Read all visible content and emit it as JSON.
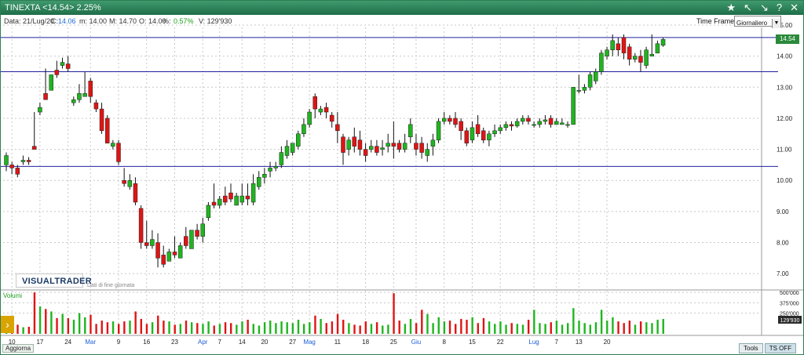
{
  "window": {
    "title": "TINEXTA <14.54> 2.25%",
    "icons": [
      "star-icon",
      "arrow-nw-icon",
      "arrow-se-icon",
      "help-icon",
      "close-icon"
    ]
  },
  "info": {
    "date": "Data: 21/Lug/20",
    "close_label": "C:",
    "close_value": "14.06",
    "min": "m: 14.00",
    "max": "M: 14.70",
    "open": "O: 14.00",
    "pct_label": "%:",
    "pct_value": "0.57%",
    "vol": "V: 129'930",
    "timeframe_label": "Time Frame",
    "timeframe_value": "Giornaliero"
  },
  "brand": {
    "name": "VISUALTRADER",
    "subtitle": "Dati di fine giornata"
  },
  "volume_label": "Volumi",
  "last_price_tag": "14.54",
  "volume_tag": "129'930",
  "bottom": {
    "update": "Aggiorna",
    "tools": "Tools",
    "ts": "TS OFF"
  },
  "colors": {
    "up": "#1fb51f",
    "down": "#e01414",
    "grid": "#c8c8c8",
    "hline": "#2020a0",
    "brand": "#1a3a66"
  },
  "chart_data": {
    "type": "candlestick",
    "price_axis": {
      "min": 6.5,
      "max": 15.0,
      "ticks": [
        "7.00",
        "8.00",
        "9.00",
        "10.00",
        "11.00",
        "12.00",
        "13.00",
        "14.00",
        "15.00"
      ]
    },
    "horizontal_lines": [
      14.6,
      13.5,
      10.45
    ],
    "volume_axis": {
      "max": 520000,
      "ticks": [
        "500'000",
        "375'000",
        "250'000"
      ]
    },
    "x_ticks": [
      {
        "label": "10",
        "i": 1,
        "month": false
      },
      {
        "label": "17",
        "i": 6,
        "month": false
      },
      {
        "label": "24",
        "i": 11,
        "month": false
      },
      {
        "label": "Mar",
        "i": 15,
        "month": true
      },
      {
        "label": "9",
        "i": 20,
        "month": false
      },
      {
        "label": "16",
        "i": 25,
        "month": false
      },
      {
        "label": "23",
        "i": 30,
        "month": false
      },
      {
        "label": "Apr",
        "i": 35,
        "month": true
      },
      {
        "label": "7",
        "i": 38,
        "month": false
      },
      {
        "label": "14",
        "i": 42,
        "month": false
      },
      {
        "label": "20",
        "i": 46,
        "month": false
      },
      {
        "label": "27",
        "i": 51,
        "month": false
      },
      {
        "label": "Mag",
        "i": 54,
        "month": true
      },
      {
        "label": "11",
        "i": 59,
        "month": false
      },
      {
        "label": "18",
        "i": 64,
        "month": false
      },
      {
        "label": "25",
        "i": 69,
        "month": false
      },
      {
        "label": "Giu",
        "i": 73,
        "month": true
      },
      {
        "label": "8",
        "i": 78,
        "month": false
      },
      {
        "label": "15",
        "i": 83,
        "month": false
      },
      {
        "label": "22",
        "i": 88,
        "month": false
      },
      {
        "label": "Lug",
        "i": 94,
        "month": true
      },
      {
        "label": "7",
        "i": 98,
        "month": false
      },
      {
        "label": "13",
        "i": 102,
        "month": false
      },
      {
        "label": "20",
        "i": 107,
        "month": false
      }
    ],
    "candles": [
      [
        10.5,
        10.9,
        10.8,
        10.3,
        160000
      ],
      [
        10.5,
        10.6,
        10.4,
        10.2,
        90000
      ],
      [
        10.4,
        10.5,
        10.2,
        10.1,
        110000
      ],
      [
        10.6,
        10.8,
        10.65,
        10.5,
        80000
      ],
      [
        10.65,
        10.75,
        10.6,
        10.5,
        85000
      ],
      [
        11.1,
        12.2,
        11.0,
        11.0,
        500000
      ],
      [
        12.2,
        12.5,
        12.35,
        12.1,
        330000
      ],
      [
        12.8,
        13.6,
        12.6,
        12.6,
        300000
      ],
      [
        12.9,
        13.4,
        13.4,
        12.9,
        270000
      ],
      [
        13.55,
        13.85,
        13.4,
        13.3,
        190000
      ],
      [
        13.7,
        13.95,
        13.8,
        13.6,
        240000
      ],
      [
        13.75,
        14.0,
        13.6,
        13.5,
        190000
      ],
      [
        12.5,
        12.7,
        12.6,
        12.4,
        170000
      ],
      [
        12.6,
        13.1,
        12.8,
        12.5,
        250000
      ],
      [
        12.7,
        13.5,
        12.8,
        12.7,
        200000
      ],
      [
        13.2,
        13.3,
        12.7,
        12.5,
        230000
      ],
      [
        12.5,
        12.6,
        12.3,
        12.2,
        120000
      ],
      [
        12.3,
        12.5,
        11.6,
        11.5,
        160000
      ],
      [
        12.0,
        12.1,
        11.2,
        11.2,
        140000
      ],
      [
        11.1,
        11.3,
        11.2,
        11.0,
        150000
      ],
      [
        11.2,
        11.3,
        10.6,
        10.5,
        120000
      ],
      [
        10.0,
        10.4,
        9.9,
        9.8,
        150000
      ],
      [
        9.8,
        10.2,
        10.0,
        9.7,
        160000
      ],
      [
        9.9,
        10.1,
        9.3,
        9.2,
        270000
      ],
      [
        9.1,
        9.2,
        8.0,
        7.8,
        180000
      ],
      [
        8.0,
        8.7,
        7.9,
        7.8,
        120000
      ],
      [
        7.9,
        8.4,
        8.1,
        7.8,
        140000
      ],
      [
        8.0,
        8.3,
        7.5,
        7.2,
        220000
      ],
      [
        7.6,
        7.9,
        7.3,
        7.2,
        160000
      ],
      [
        7.4,
        7.8,
        7.7,
        7.4,
        150000
      ],
      [
        7.7,
        8.2,
        7.6,
        7.5,
        110000
      ],
      [
        7.5,
        8.0,
        7.9,
        7.5,
        120000
      ],
      [
        8.2,
        8.5,
        7.9,
        7.8,
        160000
      ],
      [
        7.8,
        8.1,
        8.4,
        7.8,
        140000
      ],
      [
        8.4,
        8.6,
        8.2,
        8.1,
        130000
      ],
      [
        8.2,
        8.8,
        8.6,
        8.0,
        120000
      ],
      [
        8.8,
        9.3,
        9.2,
        8.7,
        150000
      ],
      [
        9.3,
        9.9,
        9.2,
        9.1,
        100000
      ],
      [
        9.2,
        9.5,
        9.4,
        9.1,
        120000
      ],
      [
        9.5,
        9.8,
        9.3,
        9.2,
        140000
      ],
      [
        9.6,
        9.9,
        9.4,
        9.3,
        130000
      ],
      [
        9.2,
        9.6,
        9.5,
        9.2,
        110000
      ],
      [
        9.3,
        9.9,
        9.5,
        9.2,
        150000
      ],
      [
        9.5,
        9.9,
        9.4,
        9.2,
        170000
      ],
      [
        9.3,
        10.2,
        9.9,
        9.2,
        120000
      ],
      [
        9.8,
        10.3,
        10.1,
        9.7,
        100000
      ],
      [
        10.1,
        10.4,
        10.2,
        9.9,
        140000
      ],
      [
        10.3,
        10.6,
        10.4,
        10.1,
        160000
      ],
      [
        10.4,
        10.6,
        10.45,
        10.3,
        130000
      ],
      [
        10.5,
        11.1,
        10.9,
        10.4,
        150000
      ],
      [
        10.8,
        11.3,
        11.1,
        10.7,
        140000
      ],
      [
        10.9,
        11.2,
        11.2,
        10.8,
        130000
      ],
      [
        11.1,
        11.6,
        11.5,
        11.0,
        170000
      ],
      [
        11.5,
        12.0,
        11.8,
        11.4,
        120000
      ],
      [
        11.8,
        12.3,
        12.2,
        11.7,
        140000
      ],
      [
        12.7,
        12.8,
        12.3,
        12.0,
        220000
      ],
      [
        12.2,
        12.4,
        12.3,
        12.1,
        180000
      ],
      [
        12.35,
        12.5,
        12.2,
        12.0,
        130000
      ],
      [
        12.1,
        12.2,
        11.9,
        11.7,
        150000
      ],
      [
        11.8,
        12.2,
        11.6,
        11.2,
        240000
      ],
      [
        11.4,
        11.5,
        10.9,
        10.5,
        170000
      ],
      [
        11.0,
        11.4,
        11.3,
        10.8,
        130000
      ],
      [
        11.4,
        11.7,
        11.1,
        10.9,
        110000
      ],
      [
        11.3,
        11.6,
        11.0,
        10.8,
        100000
      ],
      [
        11.0,
        11.2,
        10.8,
        10.6,
        150000
      ],
      [
        11.0,
        11.3,
        11.1,
        10.9,
        120000
      ],
      [
        11.1,
        11.3,
        10.9,
        10.8,
        140000
      ],
      [
        11.0,
        11.3,
        11.05,
        10.8,
        100000
      ],
      [
        11.1,
        11.5,
        11.2,
        10.9,
        110000
      ],
      [
        11.2,
        11.9,
        11.1,
        10.7,
        490000
      ],
      [
        11.2,
        11.3,
        11.0,
        10.9,
        160000
      ],
      [
        11.0,
        11.5,
        11.2,
        10.9,
        120000
      ],
      [
        11.4,
        12.0,
        11.8,
        11.2,
        180000
      ],
      [
        11.2,
        11.5,
        11.0,
        10.8,
        130000
      ],
      [
        11.2,
        11.4,
        10.9,
        10.7,
        290000
      ],
      [
        10.8,
        11.2,
        11.0,
        10.6,
        240000
      ],
      [
        11.1,
        11.5,
        11.3,
        10.8,
        130000
      ],
      [
        11.3,
        12.0,
        11.9,
        11.2,
        200000
      ],
      [
        11.9,
        12.2,
        12.0,
        11.8,
        150000
      ],
      [
        12.0,
        12.1,
        11.9,
        11.8,
        160000
      ],
      [
        12.0,
        12.2,
        11.8,
        11.7,
        120000
      ],
      [
        11.9,
        12.0,
        11.6,
        11.3,
        180000
      ],
      [
        11.6,
        11.7,
        11.2,
        11.1,
        170000
      ],
      [
        11.3,
        11.9,
        11.7,
        11.2,
        200000
      ],
      [
        11.8,
        12.1,
        11.5,
        11.4,
        130000
      ],
      [
        11.6,
        11.7,
        11.3,
        11.2,
        190000
      ],
      [
        11.3,
        11.6,
        11.5,
        11.1,
        150000
      ],
      [
        11.5,
        11.8,
        11.6,
        11.4,
        120000
      ],
      [
        11.6,
        11.8,
        11.7,
        11.5,
        150000
      ],
      [
        11.7,
        11.9,
        11.8,
        11.6,
        110000
      ],
      [
        11.8,
        11.9,
        11.75,
        11.6,
        130000
      ],
      [
        11.75,
        12.0,
        11.9,
        11.7,
        120000
      ],
      [
        11.9,
        12.1,
        12.0,
        11.8,
        110000
      ],
      [
        12.0,
        12.1,
        11.9,
        11.8,
        170000
      ],
      [
        11.8,
        11.9,
        11.8,
        11.7,
        290000
      ],
      [
        11.8,
        12.0,
        11.9,
        11.7,
        130000
      ],
      [
        11.9,
        12.1,
        11.95,
        11.8,
        120000
      ],
      [
        12.0,
        12.1,
        11.8,
        11.7,
        140000
      ],
      [
        11.8,
        12.0,
        11.9,
        11.8,
        160000
      ],
      [
        11.8,
        12.0,
        11.85,
        11.8,
        110000
      ],
      [
        11.8,
        11.9,
        11.8,
        11.7,
        130000
      ],
      [
        11.8,
        13.0,
        13.0,
        11.8,
        310000
      ],
      [
        12.9,
        13.4,
        12.9,
        12.8,
        160000
      ],
      [
        12.9,
        13.1,
        13.0,
        12.8,
        130000
      ],
      [
        13.0,
        13.5,
        13.4,
        12.9,
        110000
      ],
      [
        13.2,
        13.6,
        13.5,
        13.1,
        140000
      ],
      [
        13.5,
        14.2,
        14.1,
        13.4,
        290000
      ],
      [
        14.0,
        14.3,
        14.2,
        13.9,
        160000
      ],
      [
        14.2,
        14.7,
        14.5,
        14.0,
        200000
      ],
      [
        14.4,
        14.6,
        14.2,
        14.0,
        150000
      ],
      [
        14.6,
        14.7,
        14.1,
        13.9,
        130000
      ],
      [
        14.3,
        14.4,
        13.9,
        13.7,
        160000
      ],
      [
        13.9,
        14.1,
        14.0,
        13.8,
        110000
      ],
      [
        14.0,
        14.2,
        13.8,
        13.5,
        150000
      ],
      [
        13.7,
        14.3,
        14.2,
        13.6,
        140000
      ],
      [
        14.0,
        14.7,
        14.06,
        14.0,
        129930
      ],
      [
        14.1,
        14.5,
        14.4,
        14.1,
        170000
      ],
      [
        14.35,
        14.6,
        14.54,
        14.3,
        180000
      ]
    ]
  }
}
